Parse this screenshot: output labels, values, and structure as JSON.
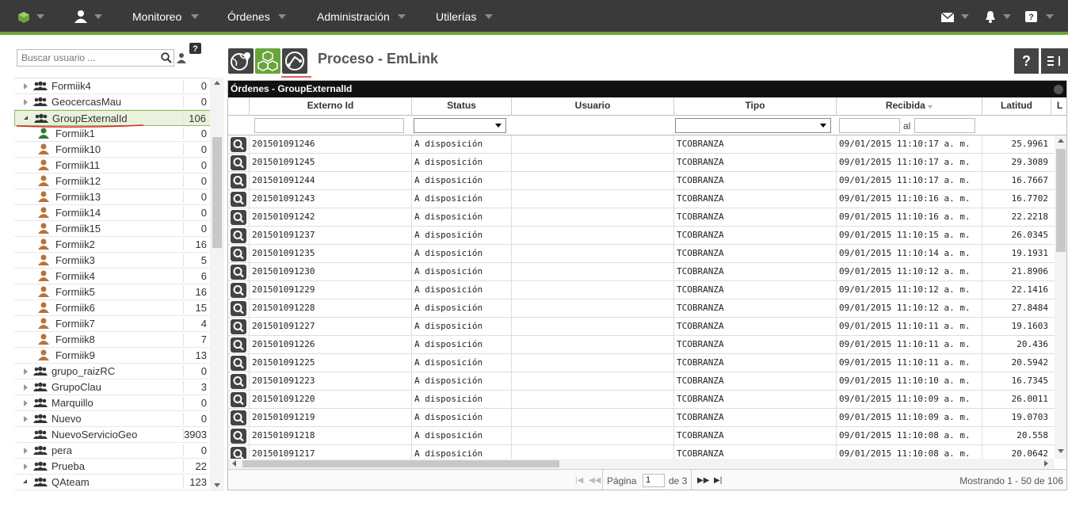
{
  "nav": {
    "items": [
      "Monitoreo",
      "Órdenes",
      "Administración",
      "Utilerías"
    ]
  },
  "sidebar": {
    "search_placeholder": "Buscar usuario ...",
    "tree": [
      {
        "label": "Formiik4",
        "count": "0",
        "kind": "group",
        "arrow": "closed"
      },
      {
        "label": "GeocercasMau",
        "count": "0",
        "kind": "group",
        "arrow": "closed"
      },
      {
        "label": "GroupExternalId",
        "count": "106",
        "kind": "group",
        "arrow": "open",
        "selected": true
      },
      {
        "label": "Formiik1",
        "count": "0",
        "kind": "user-green"
      },
      {
        "label": "Formiik10",
        "count": "0",
        "kind": "user"
      },
      {
        "label": "Formiik11",
        "count": "0",
        "kind": "user"
      },
      {
        "label": "Formiik12",
        "count": "0",
        "kind": "user"
      },
      {
        "label": "Formiik13",
        "count": "0",
        "kind": "user"
      },
      {
        "label": "Formiik14",
        "count": "0",
        "kind": "user"
      },
      {
        "label": "Formiik15",
        "count": "0",
        "kind": "user"
      },
      {
        "label": "Formiik2",
        "count": "16",
        "kind": "user"
      },
      {
        "label": "Formiik3",
        "count": "5",
        "kind": "user"
      },
      {
        "label": "Formiik4",
        "count": "6",
        "kind": "user"
      },
      {
        "label": "Formiik5",
        "count": "16",
        "kind": "user"
      },
      {
        "label": "Formiik6",
        "count": "15",
        "kind": "user"
      },
      {
        "label": "Formiik7",
        "count": "4",
        "kind": "user"
      },
      {
        "label": "Formiik8",
        "count": "7",
        "kind": "user"
      },
      {
        "label": "Formiik9",
        "count": "13",
        "kind": "user"
      },
      {
        "label": "grupo_raizRC",
        "count": "0",
        "kind": "group",
        "arrow": "closed"
      },
      {
        "label": "GrupoClau",
        "count": "3",
        "kind": "group",
        "arrow": "closed"
      },
      {
        "label": "Marquillo",
        "count": "0",
        "kind": "group",
        "arrow": "closed"
      },
      {
        "label": "Nuevo",
        "count": "0",
        "kind": "group",
        "arrow": "closed"
      },
      {
        "label": "NuevoServicioGeo",
        "count": "3903",
        "kind": "group",
        "arrow": "none"
      },
      {
        "label": "pera",
        "count": "0",
        "kind": "group",
        "arrow": "closed"
      },
      {
        "label": "Prueba",
        "count": "22",
        "kind": "group",
        "arrow": "closed"
      },
      {
        "label": "QAteam",
        "count": "123",
        "kind": "group",
        "arrow": "open"
      }
    ]
  },
  "header": {
    "title": "Proceso - EmLink",
    "help_label": "?"
  },
  "grid": {
    "caption": "Órdenes - GroupExternalId",
    "columns": [
      "Externo Id",
      "Status",
      "Usuario",
      "Tipo",
      "Recibida",
      "Latitud",
      "L"
    ],
    "filter_al": "al",
    "rows": [
      [
        "201501091246",
        "A disposición",
        "",
        "TCOBRANZA",
        "09/01/2015 11:10:17 a. m.",
        "25.9961"
      ],
      [
        "201501091245",
        "A disposición",
        "",
        "TCOBRANZA",
        "09/01/2015 11:10:17 a. m.",
        "29.3089"
      ],
      [
        "201501091244",
        "A disposición",
        "",
        "TCOBRANZA",
        "09/01/2015 11:10:17 a. m.",
        "16.7667"
      ],
      [
        "201501091243",
        "A disposición",
        "",
        "TCOBRANZA",
        "09/01/2015 11:10:16 a. m.",
        "16.7702"
      ],
      [
        "201501091242",
        "A disposición",
        "",
        "TCOBRANZA",
        "09/01/2015 11:10:16 a. m.",
        "22.2218"
      ],
      [
        "201501091237",
        "A disposición",
        "",
        "TCOBRANZA",
        "09/01/2015 11:10:15 a. m.",
        "26.0345"
      ],
      [
        "201501091235",
        "A disposición",
        "",
        "TCOBRANZA",
        "09/01/2015 11:10:14 a. m.",
        "19.1931"
      ],
      [
        "201501091230",
        "A disposición",
        "",
        "TCOBRANZA",
        "09/01/2015 11:10:12 a. m.",
        "21.8906"
      ],
      [
        "201501091229",
        "A disposición",
        "",
        "TCOBRANZA",
        "09/01/2015 11:10:12 a. m.",
        "22.1416"
      ],
      [
        "201501091228",
        "A disposición",
        "",
        "TCOBRANZA",
        "09/01/2015 11:10:12 a. m.",
        "27.8484"
      ],
      [
        "201501091227",
        "A disposición",
        "",
        "TCOBRANZA",
        "09/01/2015 11:10:11 a. m.",
        "19.1603"
      ],
      [
        "201501091226",
        "A disposición",
        "",
        "TCOBRANZA",
        "09/01/2015 11:10:11 a. m.",
        "20.436"
      ],
      [
        "201501091225",
        "A disposición",
        "",
        "TCOBRANZA",
        "09/01/2015 11:10:11 a. m.",
        "20.5942"
      ],
      [
        "201501091223",
        "A disposición",
        "",
        "TCOBRANZA",
        "09/01/2015 11:10:10 a. m.",
        "16.7345"
      ],
      [
        "201501091220",
        "A disposición",
        "",
        "TCOBRANZA",
        "09/01/2015 11:10:09 a. m.",
        "26.0011"
      ],
      [
        "201501091219",
        "A disposición",
        "",
        "TCOBRANZA",
        "09/01/2015 11:10:09 a. m.",
        "19.0703"
      ],
      [
        "201501091218",
        "A disposición",
        "",
        "TCOBRANZA",
        "09/01/2015 11:10:08 a. m.",
        "20.558"
      ],
      [
        "201501091217",
        "A disposición",
        "",
        "TCOBRANZA",
        "09/01/2015 11:10:08 a. m.",
        "20.0642"
      ]
    ]
  },
  "pager": {
    "page_label": "Página",
    "page_value": "1",
    "of_label": "de 3",
    "summary": "Mostrando 1 - 50 de 106"
  },
  "colors": {
    "topbar": "#3a3a3a",
    "accent_green": "#6aa53a",
    "user_icon": "#b8733a"
  }
}
